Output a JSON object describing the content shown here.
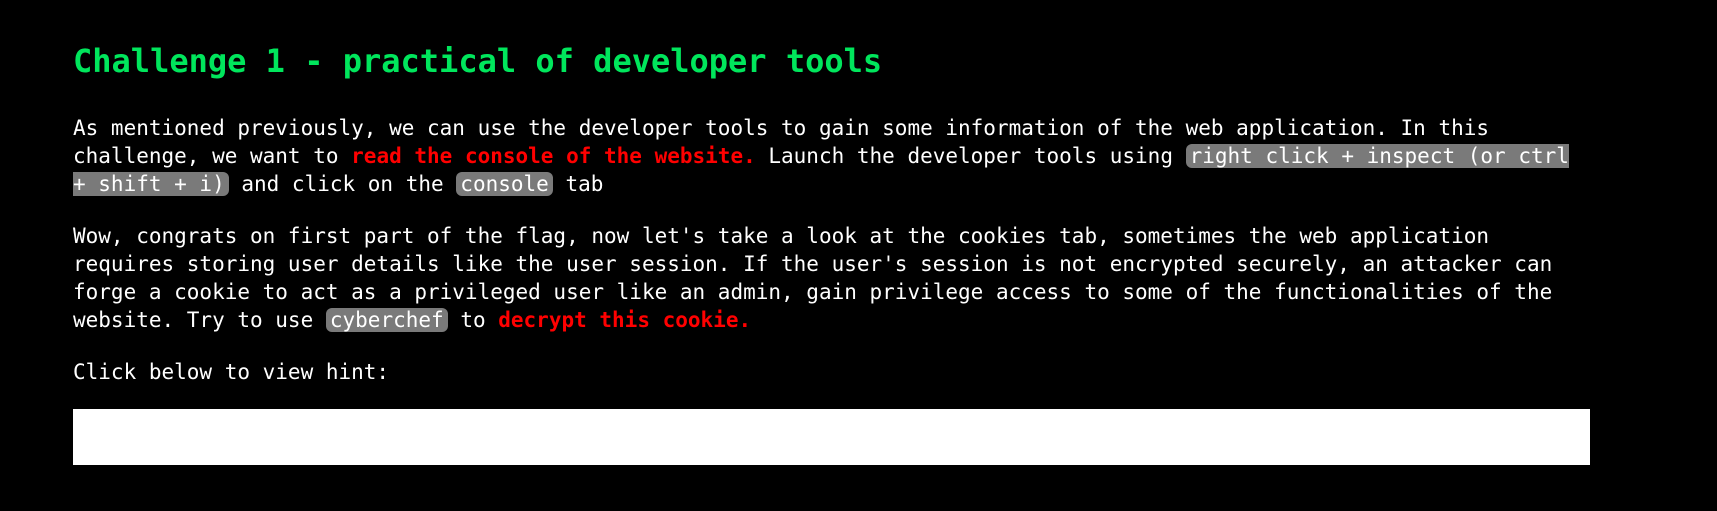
{
  "page": {
    "title": "Challenge 1 - practical of developer tools",
    "paragraph1": {
      "text1": "As mentioned previously, we can use the developer tools to gain some information of the web application. In this challenge, we want to ",
      "highlight": "read the console of the website.",
      "text2": " Launch the developer tools using ",
      "code1": "right click + inspect (or ctrl + shift + i)",
      "text3": " and click on the ",
      "code2": "console",
      "text4": " tab"
    },
    "paragraph2": {
      "text1": "Wow, congrats on first part of the flag, now let's take a look at the cookies tab, sometimes the web application requires storing user details like the user session. If the user's session is not encrypted securely, an attacker can forge a cookie to act as a privileged user like an admin, gain privilege access to some of the functionalities of the website. Try to use ",
      "code": "cyberchef",
      "text2": " to ",
      "highlight": "decrypt this cookie."
    },
    "hint_prompt": "Click below to view hint:",
    "hint_box_text": ""
  },
  "colors": {
    "background": "#000000",
    "title": "#00e65c",
    "highlight": "#ff0000",
    "code_background": "#7a7a7a",
    "hint_box": "#ffffff"
  }
}
